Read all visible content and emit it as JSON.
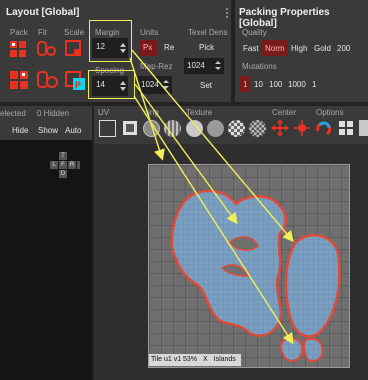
{
  "layout_panel": {
    "title": "Layout [Global]",
    "columns": {
      "pack": "Pack",
      "fit": "Fit",
      "scale": "Scale",
      "margin": "Margin",
      "units": "Units",
      "texel_dens": "Texel Dens"
    },
    "margin": {
      "value": "12"
    },
    "spacing": {
      "label": "Spacing",
      "value": "14"
    },
    "units": {
      "px": "Px",
      "re": "Re"
    },
    "pick_label": "Pick",
    "map_rez": {
      "label": "Map-Rez",
      "value": "1024"
    },
    "texel_value": "1024",
    "set_label": "Set"
  },
  "packing_panel": {
    "title": "Packing Properties [Global]",
    "quality_label": "Quality",
    "quality": [
      "Fast",
      "Norm",
      "High",
      "Gold",
      "200"
    ],
    "quality_selected": "Norm",
    "mutations_label": "Mutations",
    "mutations": [
      "1",
      "10",
      "100",
      "1000",
      "1"
    ],
    "mutations_selected": "1"
  },
  "left_toolbar": {
    "selected_label": "elected",
    "hidden_label": "0 Hidden",
    "buttons": [
      "Hide",
      "Show",
      "Auto"
    ],
    "cube_letters": {
      "top": "T",
      "left": "L",
      "front": "F",
      "right": "R",
      "back": "B",
      "bottom": "D"
    }
  },
  "uv_toolbar": {
    "uv_label": "UV",
    "spacing_label": "cing",
    "texture_label": "Texture",
    "center_label": "Center",
    "options_label": "Options"
  },
  "viewport": {
    "status": "Tile u1 v1 53%",
    "x_label": "X",
    "islands_label": "Islands"
  },
  "colors": {
    "highlight_box": "#f2ee55",
    "arrow": "#f2ee55",
    "active_red": "#d93025",
    "island_outline": "#e04a3a",
    "island_fill": "#7a9fc0"
  }
}
